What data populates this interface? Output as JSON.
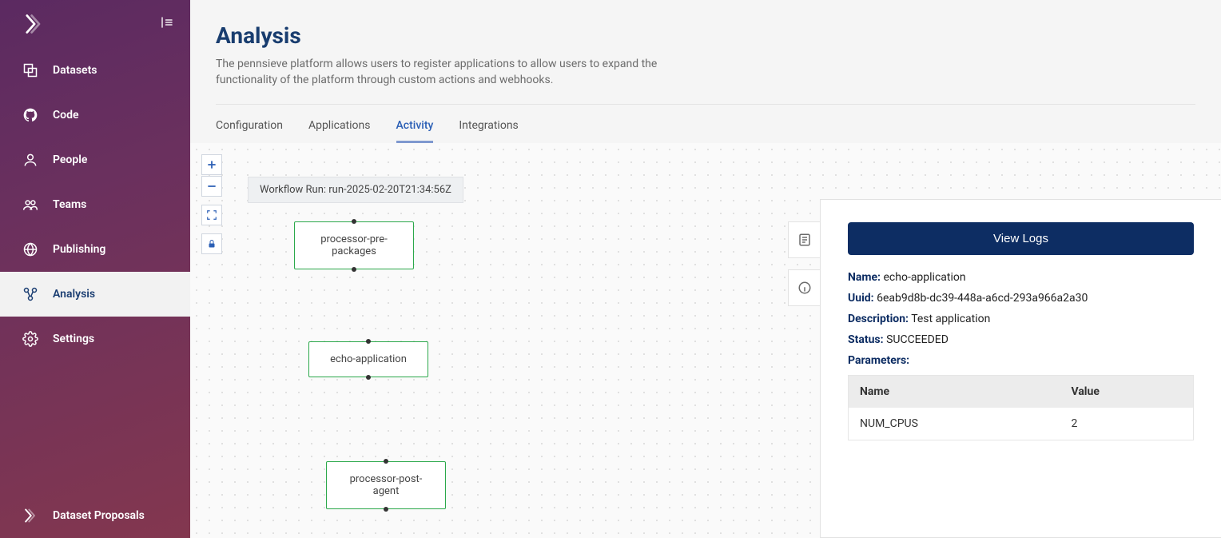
{
  "sidebar": {
    "items": [
      {
        "key": "datasets",
        "label": "Datasets"
      },
      {
        "key": "code",
        "label": "Code"
      },
      {
        "key": "people",
        "label": "People"
      },
      {
        "key": "teams",
        "label": "Teams"
      },
      {
        "key": "publishing",
        "label": "Publishing"
      },
      {
        "key": "analysis",
        "label": "Analysis"
      },
      {
        "key": "settings",
        "label": "Settings"
      }
    ],
    "footer": {
      "label": "Dataset Proposals"
    }
  },
  "header": {
    "title": "Analysis",
    "description": "The pennsieve platform allows users to register applications to allow users to expand the functionality of the platform through custom actions and webhooks."
  },
  "tabs": [
    {
      "key": "configuration",
      "label": "Configuration"
    },
    {
      "key": "applications",
      "label": "Applications"
    },
    {
      "key": "activity",
      "label": "Activity"
    },
    {
      "key": "integrations",
      "label": "Integrations"
    }
  ],
  "workflow": {
    "run_label": "Workflow Run: run-2025-02-20T21:34:56Z",
    "nodes": [
      {
        "id": "pre",
        "label": "processor-pre-packages"
      },
      {
        "id": "echo",
        "label": "echo-application"
      },
      {
        "id": "post",
        "label": "processor-post-agent"
      }
    ]
  },
  "details": {
    "view_logs_label": "View Logs",
    "name_label": "Name:",
    "name_value": "echo-application",
    "uuid_label": "Uuid:",
    "uuid_value": "6eab9d8b-dc39-448a-a6cd-293a966a2a30",
    "description_label": "Description:",
    "description_value": "Test application",
    "status_label": "Status:",
    "status_value": "SUCCEEDED",
    "parameters_label": "Parameters:",
    "param_header_name": "Name",
    "param_header_value": "Value",
    "parameters": [
      {
        "name": "NUM_CPUS",
        "value": "2"
      }
    ]
  }
}
